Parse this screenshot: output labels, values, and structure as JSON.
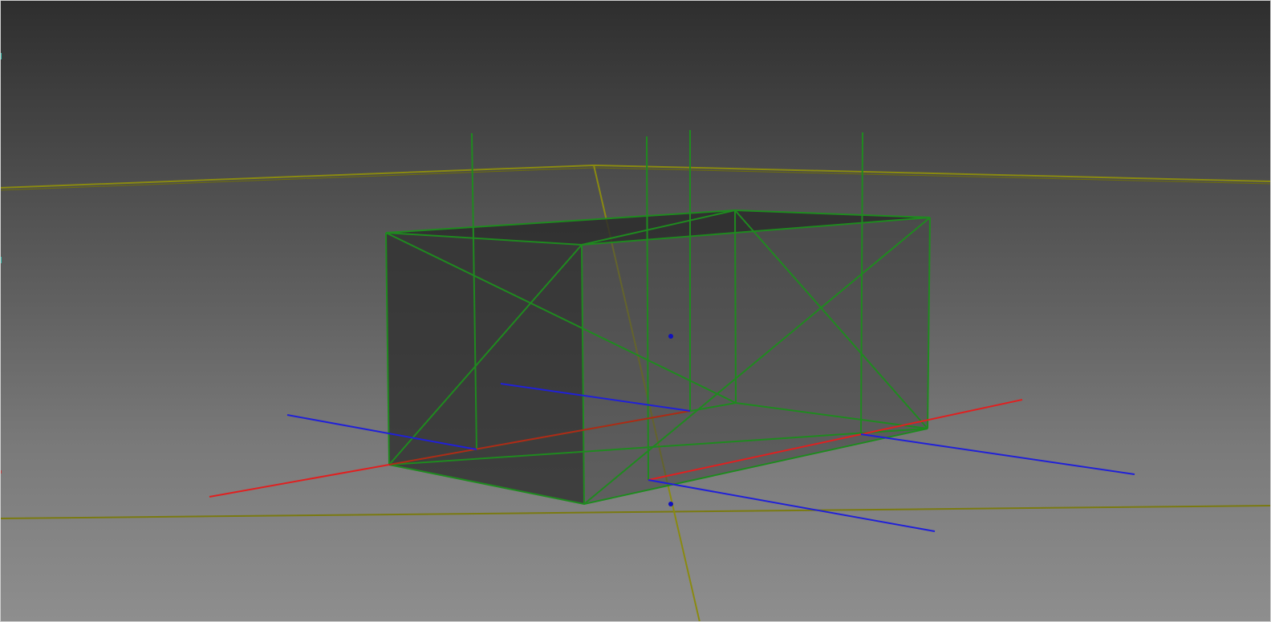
{
  "viewport": {
    "background_top": "#2e2e2e",
    "background_bottom": "#8e8e8e",
    "border_color": "#cfcfcf"
  },
  "colors": {
    "box_edges": "#1f8a1f",
    "box_fill_dark": "#2c2c2c",
    "box_fill_light": "#4a4a4a",
    "x_axis": "#e02020",
    "z_axis": "#2020d8",
    "guide_lines": "#8a8a10",
    "markers": "#1010c0",
    "edge_marker_cyan": "#40c0b0",
    "edge_marker_red": "#c04040"
  },
  "icons": [
    "viewport-edge-marker"
  ]
}
